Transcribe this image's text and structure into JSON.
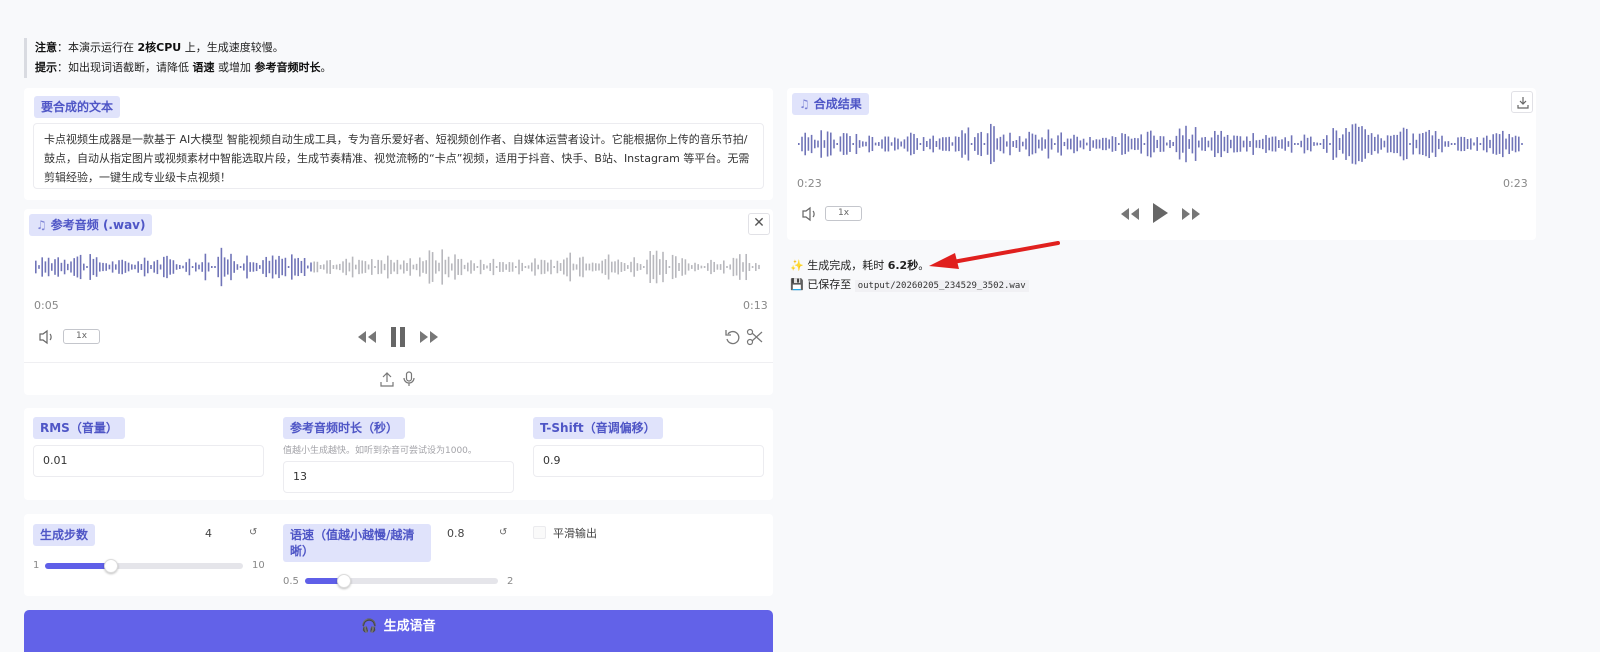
{
  "notice": {
    "note_label": "注意",
    "note_pre": "：本演示运行在 ",
    "note_bold": "2核CPU",
    "note_post": " 上，生成速度较慢。",
    "tip_label": "提示",
    "tip_pre": "：如出现词语截断，请降低 ",
    "tip_bold1": "语速",
    "tip_mid": " 或增加 ",
    "tip_bold2": "参考音频时长",
    "tip_post": "。"
  },
  "text_input": {
    "label": "要合成的文本",
    "value": "卡点视频生成器是一款基于 AI大模型 智能视频自动生成工具，专为音乐爱好者、短视频创作者、自媒体运营者设计。它能根据你上传的音乐节拍/鼓点，自动从指定图片或视频素材中智能选取片段，生成节奏精准、视觉流畅的“卡点”视频，适用于抖音、快手、B站、Instagram 等平台。无需剪辑经验，一键生成专业级卡点视频！"
  },
  "ref_audio": {
    "label": "参考音频 (.wav)",
    "current_time": "0:05",
    "duration": "0:13",
    "speed": "1x",
    "progress": 0.38
  },
  "result_audio": {
    "label": "合成结果",
    "current_time": "0:23",
    "duration": "0:23",
    "speed": "1x"
  },
  "params": {
    "rms_label": "RMS（音量）",
    "rms_value": "0.01",
    "ref_dur_label": "参考音频时长（秒）",
    "ref_dur_hint": "值越小生成越快。如听到杂音可尝试设为1000。",
    "ref_dur_value": "13",
    "tshift_label": "T-Shift（音调偏移）",
    "tshift_value": "0.9"
  },
  "sliders": {
    "steps": {
      "label": "生成步数",
      "value": "4",
      "min": "1",
      "max": "10",
      "fraction": 0.333
    },
    "speed": {
      "label": "语速（值越小越慢/越清晰）",
      "value": "0.8",
      "min": "0.5",
      "max": "2",
      "fraction": 0.2
    },
    "smooth_label": "平滑输出"
  },
  "generate_button": "生成语音",
  "status": {
    "done_prefix": "生成完成，耗时 ",
    "done_time": "6.2秒",
    "done_suffix": "。",
    "saved_prefix": "已保存至 ",
    "saved_path": "output/20260205_234529_3502.wav"
  },
  "colors": {
    "accent": "#6262e8",
    "tag_bg": "#e0e3fb",
    "wave_played": "#7074b8",
    "wave_unplayed": "#b8b8bd",
    "arrow": "#e0201e"
  }
}
